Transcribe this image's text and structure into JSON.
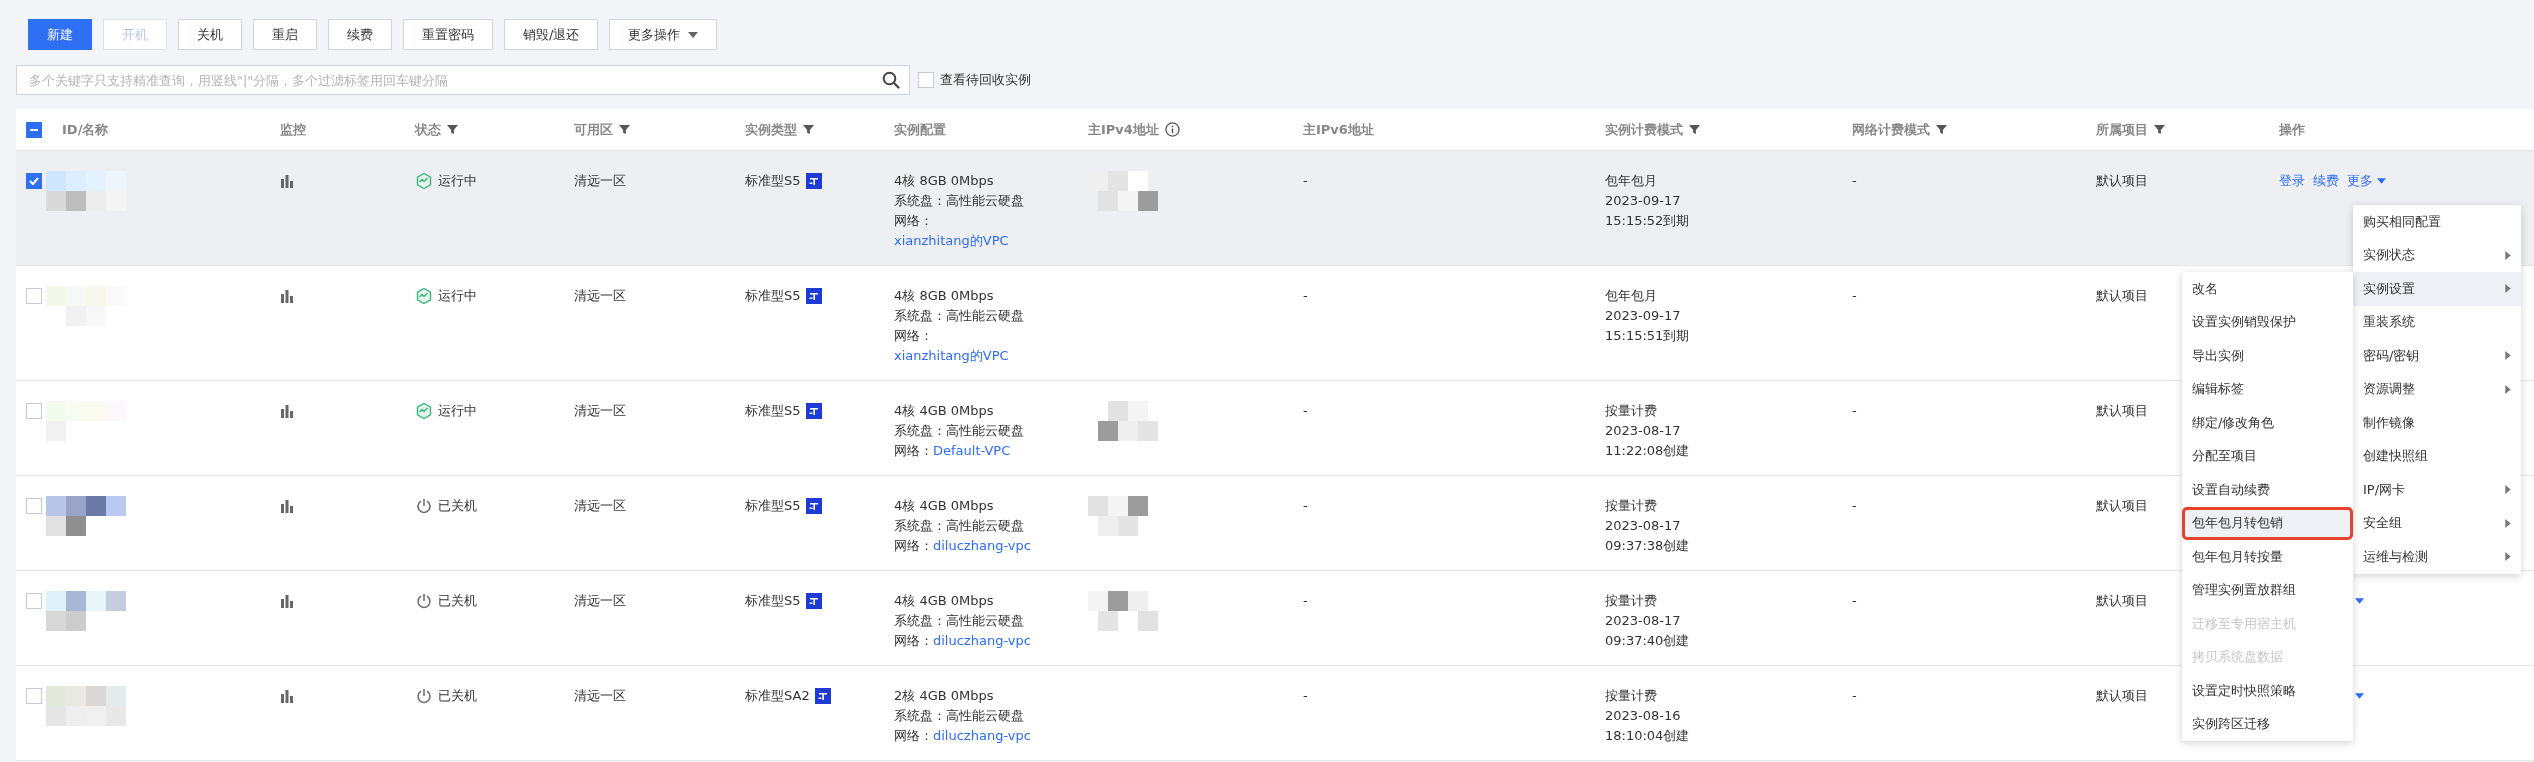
{
  "toolbar": {
    "buttons": [
      {
        "label": "新建",
        "kind": "primary",
        "disabled": false
      },
      {
        "label": "开机",
        "kind": "default",
        "disabled": true
      },
      {
        "label": "关机",
        "kind": "default",
        "disabled": false
      },
      {
        "label": "重启",
        "kind": "default",
        "disabled": false
      },
      {
        "label": "续费",
        "kind": "default",
        "disabled": false
      },
      {
        "label": "重置密码",
        "kind": "default",
        "disabled": false
      },
      {
        "label": "销毁/退还",
        "kind": "default",
        "disabled": false
      },
      {
        "label": "更多操作",
        "kind": "dropdown",
        "disabled": false
      }
    ]
  },
  "search": {
    "placeholder": "多个关键字只支持精准查询，用竖线\"|\"分隔，多个过滤标签用回车键分隔",
    "recycle_checkbox": {
      "label": "查看待回收实例",
      "checked": false
    }
  },
  "table": {
    "select_all": {
      "indeterminate": true
    },
    "columns": [
      {
        "label": "ID/名称"
      },
      {
        "label": "监控"
      },
      {
        "label": "状态",
        "filter": true
      },
      {
        "label": "可用区",
        "filter": true
      },
      {
        "label": "实例类型",
        "filter": true
      },
      {
        "label": "实例配置"
      },
      {
        "label": "主IPv4地址",
        "info": true
      },
      {
        "label": "主IPv6地址"
      },
      {
        "label": "实例计费模式",
        "filter": true
      },
      {
        "label": "网络计费模式",
        "filter": true
      },
      {
        "label": "所属项目",
        "filter": true
      },
      {
        "label": "操作"
      }
    ],
    "rows": [
      {
        "selected": true,
        "ipv4_masked": true,
        "status": {
          "kind": "running",
          "text": "运行中"
        },
        "zone": "清远一区",
        "type": "标准型S5",
        "config": {
          "spec": "4核 8GB 0Mbps",
          "disk": "系统盘：高性能云硬盘",
          "network_label": "网络：",
          "network": "xianzhitang的VPC"
        },
        "ipv6": "-",
        "billing": [
          "包年包月",
          "2023-09-17",
          "15:15:52到期"
        ],
        "net_billing": "-",
        "project": "默认项目",
        "actions": [
          "登录",
          "续费",
          "更多"
        ],
        "more_caret": true
      },
      {
        "selected": false,
        "ipv4_masked": false,
        "status": {
          "kind": "running",
          "text": "运行中"
        },
        "zone": "清远一区",
        "type": "标准型S5",
        "config": {
          "spec": "4核 8GB 0Mbps",
          "disk": "系统盘：高性能云硬盘",
          "network_label": "网络：",
          "network": "xianzhitang的VPC"
        },
        "ipv6": "-",
        "billing": [
          "包年包月",
          "2023-09-17",
          "15:15:51到期"
        ],
        "net_billing": "-",
        "project": "默认项目"
      },
      {
        "selected": false,
        "ipv4_masked": true,
        "status": {
          "kind": "running",
          "text": "运行中"
        },
        "zone": "清远一区",
        "type": "标准型S5",
        "config": {
          "spec": "4核 4GB 0Mbps",
          "disk": "系统盘：高性能云硬盘",
          "network_label": "网络：",
          "network": "Default-VPC"
        },
        "ipv6": "-",
        "billing": [
          "按量计费",
          "2023-08-17",
          "11:22:08创建"
        ],
        "net_billing": "-",
        "project": "默认项目"
      },
      {
        "selected": false,
        "ipv4_masked": true,
        "status": {
          "kind": "stopped",
          "text": "已关机"
        },
        "zone": "清远一区",
        "type": "标准型S5",
        "config": {
          "spec": "4核 4GB 0Mbps",
          "disk": "系统盘：高性能云硬盘",
          "network_label": "网络：",
          "network": "diluczhang-vpc"
        },
        "ipv6": "-",
        "billing": [
          "按量计费",
          "2023-08-17",
          "09:37:38创建"
        ],
        "net_billing": "-",
        "project": "默认项目"
      },
      {
        "selected": false,
        "ipv4_masked": true,
        "status": {
          "kind": "stopped",
          "text": "已关机"
        },
        "zone": "清远一区",
        "type": "标准型S5",
        "config": {
          "spec": "4核 4GB 0Mbps",
          "disk": "系统盘：高性能云硬盘",
          "network_label": "网络：",
          "network": "diluczhang-vpc"
        },
        "ipv6": "-",
        "billing": [
          "按量计费",
          "2023-08-17",
          "09:37:40创建"
        ],
        "net_billing": "-",
        "project": "默认项目",
        "more_caret": true
      },
      {
        "selected": false,
        "ipv4_masked": false,
        "status": {
          "kind": "stopped",
          "text": "已关机"
        },
        "zone": "清远一区",
        "type": "标准型SA2",
        "config": {
          "spec": "2核 4GB 0Mbps",
          "disk": "系统盘：高性能云硬盘",
          "network_label": "网络：",
          "network": "diluczhang-vpc"
        },
        "ipv6": "-",
        "billing": [
          "按量计费",
          "2023-08-16",
          "18:10:04创建"
        ],
        "net_billing": "-",
        "project": "默认项目",
        "more_caret": true
      }
    ]
  },
  "more_menu": {
    "items": [
      {
        "label": "购买相同配置",
        "submenu": false,
        "selected": false
      },
      {
        "label": "实例状态",
        "submenu": true,
        "selected": false
      },
      {
        "label": "实例设置",
        "submenu": true,
        "selected": true
      },
      {
        "label": "重装系统",
        "submenu": false,
        "selected": false
      },
      {
        "label": "密码/密钥",
        "submenu": true,
        "selected": false
      },
      {
        "label": "资源调整",
        "submenu": true,
        "selected": false
      },
      {
        "label": "制作镜像",
        "submenu": false,
        "selected": false
      },
      {
        "label": "创建快照组",
        "submenu": false,
        "selected": false
      },
      {
        "label": "IP/网卡",
        "submenu": true,
        "selected": false
      },
      {
        "label": "安全组",
        "submenu": true,
        "selected": false
      },
      {
        "label": "运维与检测",
        "submenu": true,
        "selected": false
      }
    ]
  },
  "sub_menu": {
    "items": [
      {
        "label": "改名",
        "disabled": false,
        "highlighted": false
      },
      {
        "label": "设置实例销毁保护",
        "disabled": false,
        "highlighted": false
      },
      {
        "label": "导出实例",
        "disabled": false,
        "highlighted": false
      },
      {
        "label": "编辑标签",
        "disabled": false,
        "highlighted": false
      },
      {
        "label": "绑定/修改角色",
        "disabled": false,
        "highlighted": false
      },
      {
        "label": "分配至项目",
        "disabled": false,
        "highlighted": false
      },
      {
        "label": "设置自动续费",
        "disabled": false,
        "highlighted": false
      },
      {
        "label": "包年包月转包销",
        "disabled": false,
        "highlighted": true
      },
      {
        "label": "包年包月转按量",
        "disabled": false,
        "highlighted": false
      },
      {
        "label": "管理实例置放群组",
        "disabled": false,
        "highlighted": false
      },
      {
        "label": "迁移至专用宿主机",
        "disabled": true,
        "highlighted": false
      },
      {
        "label": "拷贝系统盘数据",
        "disabled": true,
        "highlighted": false
      },
      {
        "label": "设置定时快照策略",
        "disabled": false,
        "highlighted": false
      },
      {
        "label": "实例跨区迁移",
        "disabled": false,
        "highlighted": false
      }
    ]
  }
}
